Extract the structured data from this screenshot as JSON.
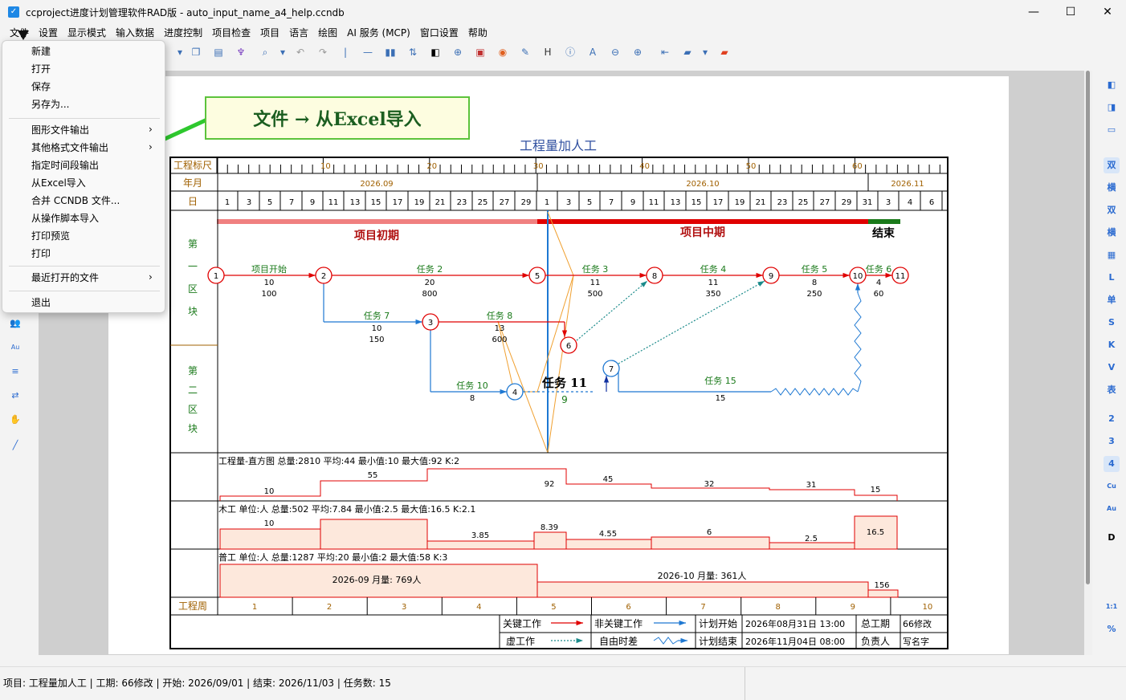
{
  "window": {
    "title": "ccproject进度计划管理软件RAD版 - auto_input_name_a4_help.ccndb",
    "min": "—",
    "max": "☐",
    "close": "✕"
  },
  "menu": [
    "文件",
    "设置",
    "显示模式",
    "输入数据",
    "进度控制",
    "项目检查",
    "项目",
    "语言",
    "绘图",
    "AI 服务 (MCP)",
    "窗口设置",
    "帮助"
  ],
  "file_menu": {
    "group1": [
      "新建",
      "打开",
      "保存",
      "另存为..."
    ],
    "group2": [
      "图形文件输出",
      "其他格式文件输出",
      "指定时间段输出",
      "从Excel导入",
      "合并 CCNDB 文件...",
      "从操作脚本导入",
      "打印预览",
      "打印"
    ],
    "submenu_items": [
      "图形文件输出",
      "其他格式文件输出"
    ],
    "group3": [
      "最近打开的文件"
    ],
    "group4": [
      "退出"
    ]
  },
  "callout": "文件 → 从Excel导入",
  "right_toolbar": [
    "双",
    "横",
    "双",
    "横",
    "L",
    "单",
    "S",
    "K",
    "V",
    "表",
    "2",
    "3",
    "4",
    "Cu",
    "Au",
    "D",
    "1:1",
    "%"
  ],
  "status": "项目: 工程量加人工 | 工期: 66修改 | 开始: 2026/09/01 | 结束: 2026/11/03 | 任务数: 15",
  "chart_data": {
    "type": "table",
    "title": "工程量加人工",
    "header_rows": {
      "ruler_label": "工程标尺",
      "ruler_ticks": [
        "10",
        "20",
        "30",
        "40",
        "50",
        "60"
      ],
      "month_label": "年月",
      "months": [
        "2026.09",
        "2026.10",
        "2026.11"
      ],
      "day_label": "日",
      "days": [
        "1",
        "3",
        "5",
        "7",
        "9",
        "11",
        "13",
        "15",
        "17",
        "19",
        "21",
        "23",
        "25",
        "27",
        "29",
        "1",
        "3",
        "5",
        "7",
        "9",
        "11",
        "13",
        "15",
        "17",
        "19",
        "21",
        "23",
        "25",
        "27",
        "29",
        "31",
        "3",
        "4",
        "6"
      ]
    },
    "phases": [
      "项目初期",
      "项目中期",
      "结束"
    ],
    "blocks": [
      "第一区块",
      "第二区块"
    ],
    "nodes": [
      "1",
      "2",
      "3",
      "4",
      "5",
      "6",
      "7",
      "8",
      "9",
      "10",
      "11"
    ],
    "tasks": [
      {
        "name": "项目开始",
        "dur": "10",
        "qty": "100"
      },
      {
        "name": "任务 2",
        "dur": "20",
        "qty": "800"
      },
      {
        "name": "任务 3",
        "dur": "11",
        "qty": "500"
      },
      {
        "name": "任务 4",
        "dur": "11",
        "qty": "350"
      },
      {
        "name": "任务 5",
        "dur": "8",
        "qty": "250"
      },
      {
        "name": "任务 6",
        "dur": "4",
        "qty": "60"
      },
      {
        "name": "任务 7",
        "dur": "10",
        "qty": "150"
      },
      {
        "name": "任务 8",
        "dur": "13",
        "qty": "600"
      },
      {
        "name": "任务 10",
        "dur": "8",
        "qty": ""
      },
      {
        "name": "任务 11",
        "dur": "9",
        "qty": ""
      },
      {
        "name": "任务 15",
        "dur": "15",
        "qty": ""
      }
    ],
    "hist1": {
      "label": "工程量-直方图 总量:2810 平均:44 最小值:10 最大值:92 K:2",
      "values": [
        "10",
        "55",
        "92",
        "45",
        "32",
        "31",
        "15"
      ]
    },
    "hist2": {
      "label": "木工 单位:人 总量:502 平均:7.84 最小值:2.5 最大值:16.5 K:2.1",
      "values": [
        "10",
        "3.85",
        "8.39",
        "4.55",
        "6",
        "2.5",
        "16.5"
      ]
    },
    "hist3": {
      "label": "普工 单位:人 总量:1287 平均:20 最小值:2 最大值:58 K:3",
      "values": [
        "2026-09 月量: 769人",
        "2026-10 月量: 361人",
        "156"
      ]
    },
    "week_label": "工程周",
    "weeks": [
      "1",
      "2",
      "3",
      "4",
      "5",
      "6",
      "7",
      "8",
      "9",
      "10"
    ],
    "legend": {
      "critical": "关键工作",
      "noncritical": "非关键工作",
      "dummy": "虚工作",
      "float": "自由时差",
      "plan_start": "计划开始",
      "plan_start_val": "2026年08月31日 13:00",
      "plan_end": "计划结束",
      "plan_end_val": "2026年11月04日 08:00",
      "total_label": "总工期",
      "total_val": "66修改",
      "owner_label": "负责人",
      "owner_val": "写名字"
    },
    "colors": {
      "critical": "#e00000",
      "noncritical": "#1e78d2",
      "dummy": "#1a8a8a",
      "hist_fill": "#fde8dc",
      "phase1": "#f08080",
      "phase2": "#e00000",
      "phase3": "#1a7a1a",
      "vline": "#1e78d2",
      "orange": "#f0a030"
    }
  }
}
